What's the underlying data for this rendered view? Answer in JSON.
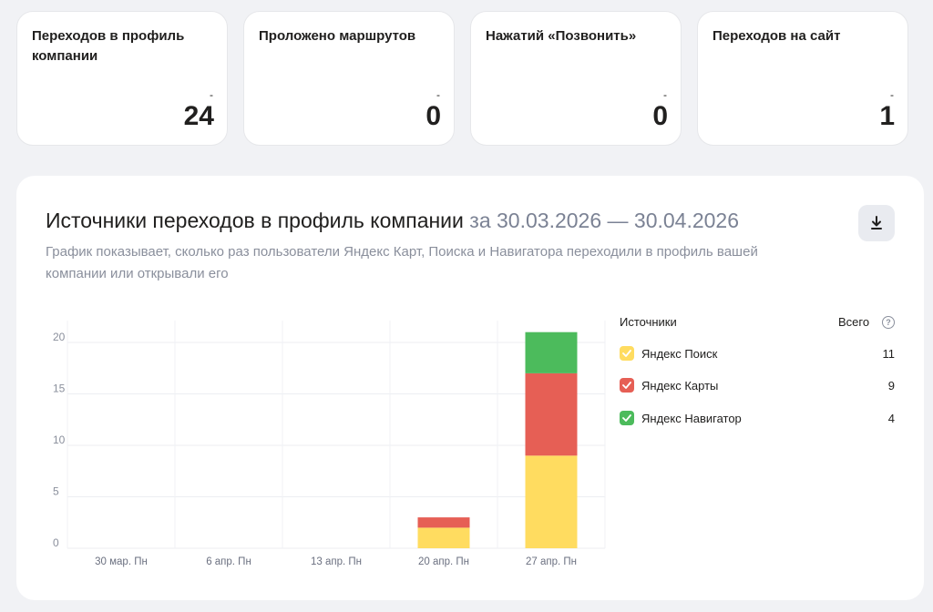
{
  "cards": [
    {
      "title": "Переходов в профиль компании",
      "delta": "-",
      "value": "24"
    },
    {
      "title": "Проложено маршрутов",
      "delta": "-",
      "value": "0"
    },
    {
      "title": "Нажатий «Позвонить»",
      "delta": "-",
      "value": "0"
    },
    {
      "title": "Переходов на сайт",
      "delta": "-",
      "value": "1"
    }
  ],
  "panel": {
    "title": "Источники переходов в профиль компании",
    "period": "за 30.03.2026 — 30.04.2026",
    "description": "График показывает, сколько раз пользователи Яндекс Карт, Поиска и Навигатора переходили в профиль вашей компании или открывали его",
    "download_icon": "download-icon"
  },
  "legend": {
    "header_sources": "Источники",
    "header_total": "Всего",
    "help_icon": "?",
    "items": [
      {
        "label": "Яндекс Поиск",
        "total": "11",
        "color": "#ffdc60"
      },
      {
        "label": "Яндекс Карты",
        "total": "9",
        "color": "#e65f55"
      },
      {
        "label": "Яндекс Навигатор",
        "total": "4",
        "color": "#4cbb5c"
      }
    ]
  },
  "chart_data": {
    "type": "bar",
    "stacked": true,
    "categories": [
      "30 мар. Пн",
      "6 апр. Пн",
      "13 апр. Пн",
      "20 апр. Пн",
      "27 апр. Пн"
    ],
    "series": [
      {
        "name": "Яндекс Поиск",
        "color": "#ffdc60",
        "values": [
          0,
          0,
          0,
          2,
          9
        ]
      },
      {
        "name": "Яндекс Карты",
        "color": "#e65f55",
        "values": [
          0,
          0,
          0,
          1,
          8
        ]
      },
      {
        "name": "Яндекс Навигатор",
        "color": "#4cbb5c",
        "values": [
          0,
          0,
          0,
          0,
          4
        ]
      }
    ],
    "yticks": [
      "0",
      "5",
      "10",
      "15",
      "20"
    ],
    "ylim": [
      0,
      20
    ],
    "grid": true,
    "legend_position": "right"
  }
}
